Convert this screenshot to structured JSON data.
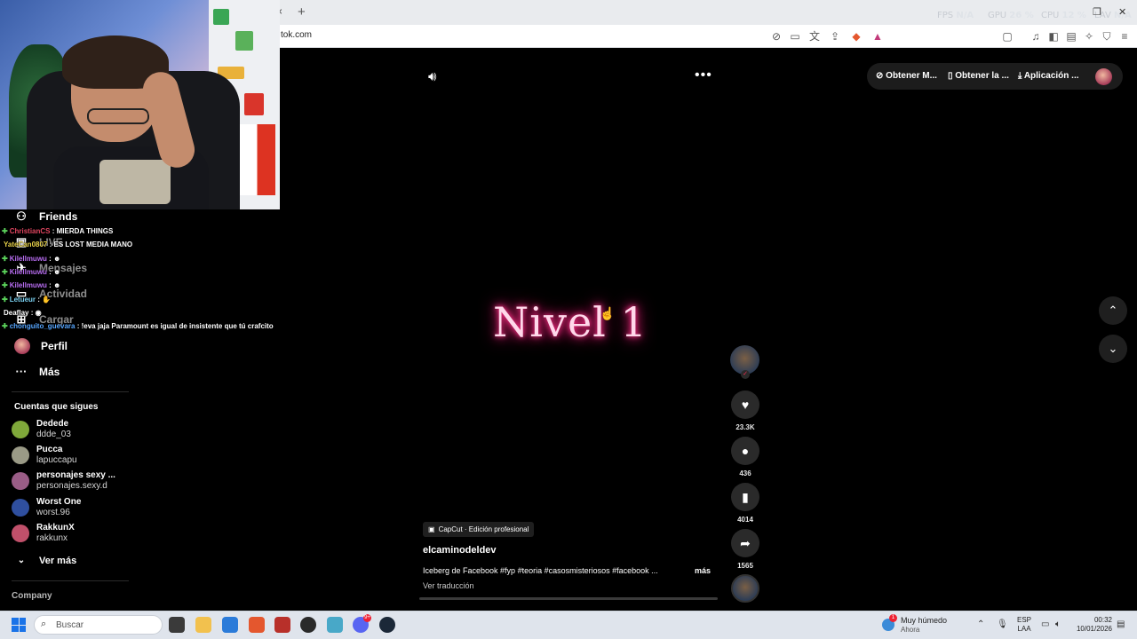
{
  "browser": {
    "new_tab": "+",
    "tab_close": "×",
    "url": "tok.com",
    "overlay": [
      {
        "label": "FPS",
        "value": "N/A"
      },
      {
        "label": "GPU",
        "value": "26 %"
      },
      {
        "label": "CPU",
        "value": "12 %"
      },
      {
        "label": "LAV",
        "value": "N/A"
      }
    ]
  },
  "sidebar": {
    "nav": [
      {
        "label": "Friends",
        "icon": "friends-icon",
        "glyph": "⚇"
      },
      {
        "label": "LIVE",
        "icon": "live-icon",
        "glyph": "▣"
      },
      {
        "label": "Mensajes",
        "icon": "messages-icon",
        "glyph": "✈"
      },
      {
        "label": "Actividad",
        "icon": "activity-icon",
        "glyph": "▭"
      },
      {
        "label": "Cargar",
        "icon": "upload-icon",
        "glyph": "⊞"
      },
      {
        "label": "Perfil",
        "icon": "profile-icon",
        "glyph": ""
      },
      {
        "label": "Más",
        "icon": "more-icon",
        "glyph": "···"
      }
    ],
    "following_title": "Cuentas que sigues",
    "accounts": [
      {
        "name": "Dedede",
        "handle": "ddde_03",
        "color": "#7fa83a"
      },
      {
        "name": "Pucca",
        "handle": "lapuccapu",
        "color": "#9a9a86"
      },
      {
        "name": "personajes sexy ...",
        "handle": "personajes.sexy.d",
        "color": "#9a5d86"
      },
      {
        "name": "Worst One",
        "handle": "worst.96",
        "color": "#2f4f9f"
      },
      {
        "name": "RakkunX",
        "handle": "rakkunx",
        "color": "#c0506a"
      }
    ],
    "see_more": "Ver más",
    "company": "Company"
  },
  "chat": [
    {
      "user": "ChristianCS",
      "msg": ": MIERDA THINGS",
      "color": "#e0455f"
    },
    {
      "user": "YateCan0807",
      "msg": ": ES LOST MEDIA MANO",
      "color": "#e8d24a"
    },
    {
      "user": "Kilellmuwu",
      "msg": ": ☻",
      "color": "#b76cf0"
    },
    {
      "user": "Kilellmuwu",
      "msg": ": ☻",
      "color": "#b76cf0"
    },
    {
      "user": "Kilellmuwu",
      "msg": ": ☻",
      "color": "#b76cf0"
    },
    {
      "user": "Letueur",
      "msg": ": ✋",
      "color": "#7ad0f0"
    },
    {
      "user": "Deaflay",
      "msg": ": ◉",
      "color": "#ffffff"
    },
    {
      "user": "chonguito_guevara",
      "msg": ": !eva jaja Paramount es igual de insistente que tú crafcito",
      "color": "#56a6ff"
    }
  ],
  "video": {
    "title": "Nivel 1",
    "capcut_label": "CapCut · Edición profesional",
    "author": "elcaminodeldev",
    "description": "Iceberg de Facebook #fyp #teoria #casosmisteriosos #facebook ...",
    "more": "más",
    "translate": "Ver traducción",
    "progress": 0.0
  },
  "actions": {
    "likes": "23.3K",
    "comments": "436",
    "saves": "4014",
    "shares": "1565"
  },
  "top_pill": {
    "item1": "Obtener M...",
    "item2": "Obtener la ...",
    "item3": "Aplicación ..."
  },
  "taskbar": {
    "search_placeholder": "Buscar",
    "weather_main": "Muy húmedo",
    "weather_sub": "Ahora",
    "weather_badge": "1",
    "lang_top": "ESP",
    "lang_bottom": "LAA",
    "time": "00:32",
    "date": "10/01/2026",
    "discord_badge": "9+"
  }
}
